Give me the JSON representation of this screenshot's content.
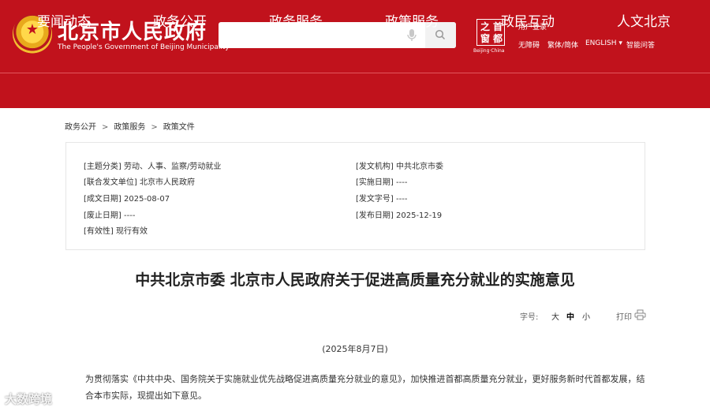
{
  "header": {
    "site_title": "北京市人民政府",
    "site_subtitle": "The People's Government of Beijing Municipality",
    "search_placeholder": "",
    "capital_logo_chars": [
      "首",
      "都",
      "之",
      "窗"
    ],
    "capital_logo_sub": "Beijing·China",
    "user_login": "用户登录",
    "utility_links": [
      "无障碍",
      "繁体/简体",
      "ENGLISH ▾",
      "智能问答"
    ]
  },
  "nav": {
    "items": [
      "要闻动态",
      "政务公开",
      "政务服务",
      "政策服务",
      "政民互动",
      "人文北京"
    ]
  },
  "breadcrumb": {
    "items": [
      "政务公开",
      "政策服务",
      "政策文件"
    ],
    "separator": ">"
  },
  "meta": {
    "left": [
      {
        "label": "[主题分类]",
        "value": "劳动、人事、监察/劳动就业"
      },
      {
        "label": "[联合发文单位]",
        "value": "北京市人民政府"
      },
      {
        "label": "[成文日期]",
        "value": "2025-08-07"
      },
      {
        "label": "[废止日期]",
        "value": "----"
      },
      {
        "label": "[有效性]",
        "value": "现行有效"
      }
    ],
    "right": [
      {
        "label": "[发文机构]",
        "value": "中共北京市委"
      },
      {
        "label": "[实施日期]",
        "value": "----"
      },
      {
        "label": "[发文字号]",
        "value": "----"
      },
      {
        "label": "[发布日期]",
        "value": "2025-12-19"
      }
    ]
  },
  "document": {
    "title": "中共北京市委 北京市人民政府关于促进高质量充分就业的实施意见",
    "font_size_label": "字号:",
    "font_sizes": [
      "大",
      "中",
      "小"
    ],
    "active_font_size": "中",
    "print_label": "打印",
    "date": "(2025年8月7日)",
    "paragraph": "为贯彻落实《中共中央、国务院关于实施就业优先战略促进高质量充分就业的意见》，加快推进首都高质量充分就业，更好服务新时代首都发展，结合本市实际，现提出如下意见。"
  },
  "watermark": "大数跨境",
  "colors": {
    "brand_red": "#c1121c"
  }
}
